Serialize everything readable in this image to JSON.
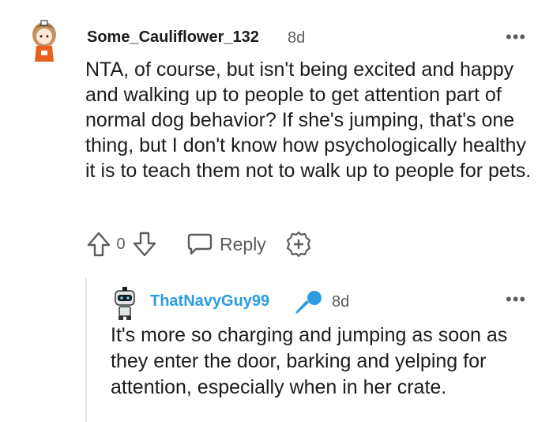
{
  "comment": {
    "username": "Some_Cauliflower_132",
    "age": "8d",
    "body": "NTA, of course, but isn't being excited and happy and walking up to people to get attention part of normal dog behavior? If she's jumping, that's one thing, but I don't know how psychologically healthy it is to teach them not to walk up to people for pets.",
    "vote_count": "0",
    "reply_label": "Reply",
    "more_label": "•••"
  },
  "reply": {
    "username": "ThatNavyGuy99",
    "age": "8d",
    "body": "It's more so charging and jumping as soon as they enter the door, barking and yelping for attention, especially when in her crate.",
    "more_label": "•••"
  },
  "colors": {
    "accent_username": "#2c9ce0",
    "muted": "#5c5c5c"
  },
  "icons": [
    "avatar",
    "more-options-icon",
    "upvote-icon",
    "downvote-icon",
    "reply-icon",
    "award-icon",
    "microphone-icon"
  ]
}
